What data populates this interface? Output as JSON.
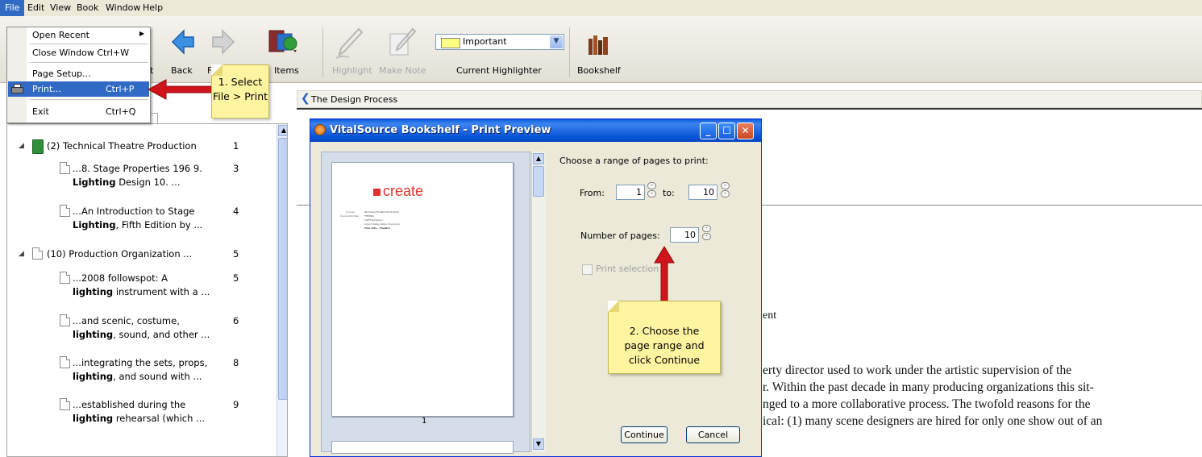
{
  "menubar": {
    "file": "File",
    "edit": "Edit",
    "view": "View",
    "book": "Book",
    "window": "Window",
    "help": "Help"
  },
  "file_menu": {
    "open_recent": "Open Recent",
    "close_window": "Close Window Ctrl+W",
    "page_setup": "Page Setup...",
    "print": "Print...",
    "print_shortcut": "Ctrl+P",
    "exit": "Exit",
    "exit_shortcut": "Ctrl+Q"
  },
  "toolbar": {
    "back": "Back",
    "items_partial": "Items",
    "highlight": "Highlight",
    "make_note": "Make Note",
    "highlighter_value": "Important",
    "current_highlighter": "Current Highlighter",
    "bookshelf": "Bookshelf",
    "partial_t": "t",
    "partial_f": "F"
  },
  "breadcrumb": "The Design Process",
  "results": [
    {
      "title": "(2) Technical Theatre Production",
      "num": "1"
    },
    {
      "line1": "...8. Stage Properties 196 9.",
      "bold": "Lighting",
      "line2": " Design 10. ...",
      "num": "3"
    },
    {
      "line1": "...An Introduction to Stage",
      "bold": "Lighting",
      "line2": ", Fifth Edition by ...",
      "num": "4"
    },
    {
      "title": "(10) Production Organization ...",
      "num": "5"
    },
    {
      "line1": "...2008 followspot: A",
      "bold": "lighting",
      "line2": " instrument with a ...",
      "num": "5"
    },
    {
      "line1": "...and scenic, costume,",
      "bold": "lighting",
      "line2": ", sound, and other ...",
      "num": "6"
    },
    {
      "line1": "...integrating the sets, props,",
      "bold": "lighting",
      "line2": ", and sound with ...",
      "num": "8"
    },
    {
      "line1": "...established during the",
      "bold": "lighting",
      "line2": " rehearsal (which ...",
      "num": "9"
    }
  ],
  "dialog": {
    "title": "VitalSource Bookshelf - Print Preview",
    "range_label": "Choose a range of pages to print:",
    "from_label": "From:",
    "from_value": "1",
    "to_label": "to:",
    "to_value": "10",
    "num_pages_label": "Number of pages:",
    "num_pages_value": "10",
    "print_selection": "Print selection",
    "continue": "Continue",
    "cancel": "Cancel",
    "page_number": "1",
    "thumb_logo": "create",
    "thumb_lines": [
      "Technical Theatre Production",
      "THE306",
      "Cliff Thompson",
      "Grand Valley State University",
      "Fine Arts - Theatre"
    ],
    "thumb_keys": [
      "Course",
      "Course Number"
    ]
  },
  "callouts": {
    "one": [
      "1. Select",
      "File > Print"
    ],
    "two": [
      "2. Choose the",
      "page range and",
      "click Continue"
    ]
  },
  "main_text": {
    "fragment": "ent",
    "l1": "erty director used to work under the artistic supervision of the",
    "l2": "r. Within the past decade in many producing organizations this sit-",
    "l3": "nged to a more collaborative process. The twofold reasons for the",
    "l4": "ical: (1) many scene designers are hired for only one show out of an"
  },
  "colors": {
    "selection": "#316ac5",
    "callout": "#fff5a1",
    "arrow": "#d0141b",
    "title_bar": "#0552d6"
  }
}
